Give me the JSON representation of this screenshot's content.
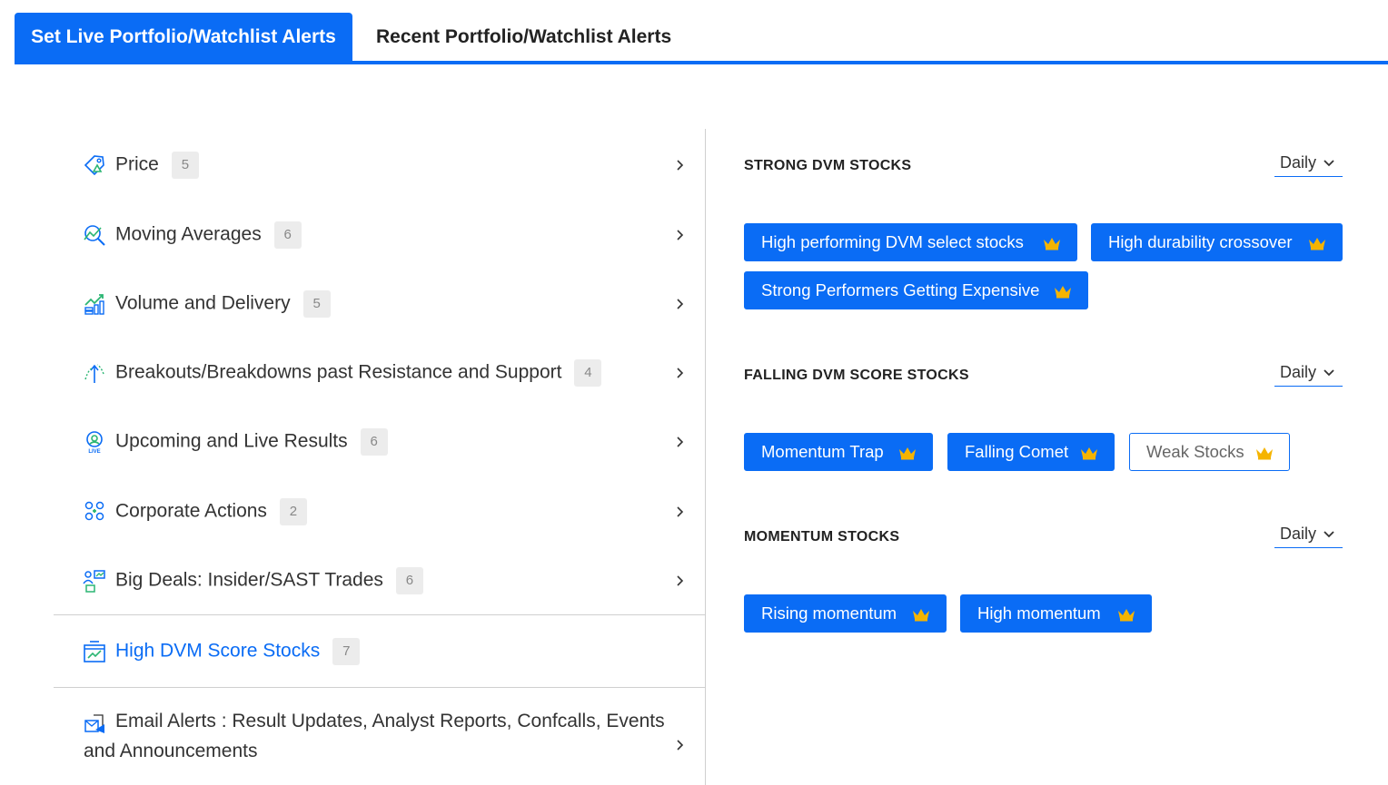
{
  "tabs": [
    {
      "label": "Set Live Portfolio/Watchlist Alerts",
      "active": true
    },
    {
      "label": "Recent Portfolio/Watchlist Alerts",
      "active": false
    }
  ],
  "menu": {
    "items": [
      {
        "label": "Price",
        "count": "5",
        "icon": "price-tag-icon"
      },
      {
        "label": "Moving Averages",
        "count": "6",
        "icon": "moving-average-icon"
      },
      {
        "label": "Volume and Delivery",
        "count": "5",
        "icon": "volume-chart-icon"
      },
      {
        "label": "Breakouts/Breakdowns past Resistance and Support",
        "count": "4",
        "icon": "breakout-arrows-icon"
      },
      {
        "label": "Upcoming and Live Results",
        "count": "6",
        "icon": "live-results-icon"
      },
      {
        "label": "Corporate Actions",
        "count": "2",
        "icon": "corporate-actions-icon"
      },
      {
        "label": "Big Deals: Insider/SAST Trades",
        "count": "6",
        "icon": "big-deals-icon"
      },
      {
        "label": "High DVM Score Stocks",
        "count": "7",
        "icon": "dvm-chart-icon",
        "active": true
      }
    ],
    "email_label": "Email Alerts : Result Updates, Analyst Reports, Confcalls, Events and Announcements"
  },
  "sections": [
    {
      "title": "STRONG DVM STOCKS",
      "frequency": "Daily",
      "pills": [
        {
          "label": "High performing DVM select stocks",
          "selected": true
        },
        {
          "label": "High durability crossover",
          "selected": true
        },
        {
          "label": "Strong Performers Getting Expensive",
          "selected": true
        }
      ]
    },
    {
      "title": "FALLING DVM SCORE STOCKS",
      "frequency": "Daily",
      "pills": [
        {
          "label": "Momentum Trap",
          "selected": true
        },
        {
          "label": "Falling Comet",
          "selected": true
        },
        {
          "label": "Weak Stocks",
          "selected": false
        }
      ]
    },
    {
      "title": "MOMENTUM STOCKS",
      "frequency": "Daily",
      "pills": [
        {
          "label": "Rising momentum",
          "selected": true
        },
        {
          "label": "High momentum",
          "selected": true
        }
      ]
    }
  ],
  "colors": {
    "accent": "#0a6cf5",
    "crown": "#f5b400",
    "icon_green": "#2bb673"
  }
}
